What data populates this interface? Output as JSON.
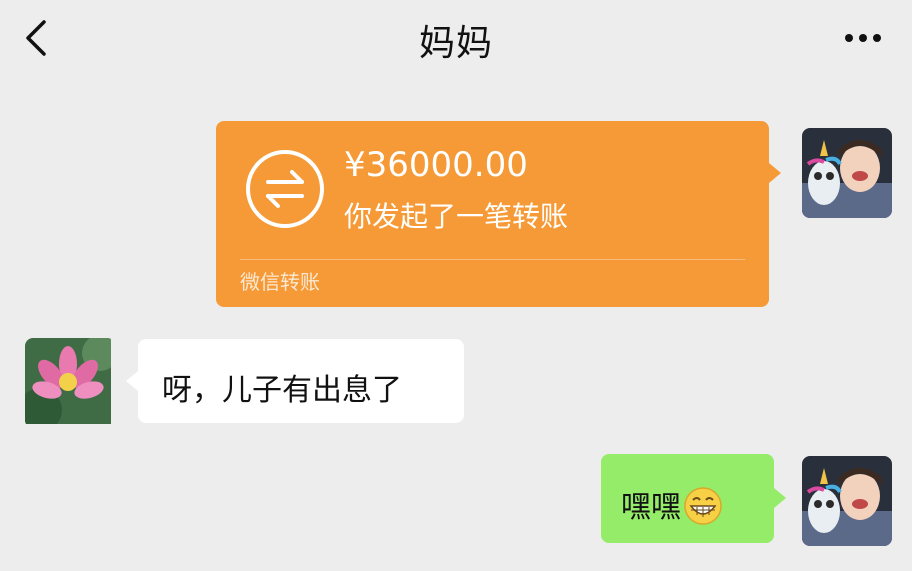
{
  "header": {
    "title": "妈妈",
    "back_icon": "chevron-left-icon",
    "more_icon": "more-horizontal-icon"
  },
  "messages": [
    {
      "type": "transfer",
      "direction": "outgoing",
      "amount": "¥36000.00",
      "description": "你发起了一笔转账",
      "source": "微信转账",
      "icon": "transfer-arrows-icon",
      "color": "#f59a36"
    },
    {
      "type": "text",
      "direction": "incoming",
      "text": "呀，儿子有出息了",
      "color": "#ffffff"
    },
    {
      "type": "text",
      "direction": "outgoing",
      "text": "嘿嘿",
      "emoji": "grinning-face-emoji",
      "color": "#95ec69"
    }
  ],
  "avatars": {
    "self": "child-with-toy-avatar",
    "mother": "lotus-flower-avatar"
  },
  "colors": {
    "background": "#ededed",
    "transfer": "#f59a36",
    "outgoing_bubble": "#95ec69",
    "incoming_bubble": "#ffffff"
  }
}
